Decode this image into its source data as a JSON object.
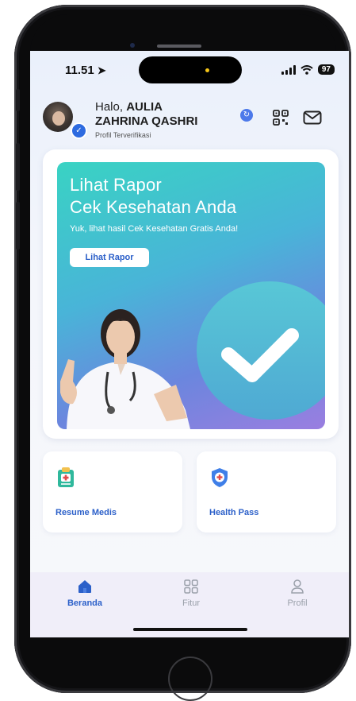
{
  "status_bar": {
    "time": "11.51",
    "location_glyph": "➤",
    "battery": "97"
  },
  "header": {
    "greeting_prefix": "Halo, ",
    "name_line1": "AULIA",
    "name_line2": "ZAHRINA QASHRI",
    "verified_label": "Profil Terverifikasi",
    "sync_glyph": "↻"
  },
  "banner": {
    "title_line1": "Lihat Rapor",
    "title_line2": "Cek Kesehatan Anda",
    "subtitle": "Yuk, lihat hasil Cek Kesehatan Gratis Anda!",
    "button_label": "Lihat Rapor"
  },
  "features": [
    {
      "label": "Resume Medis",
      "icon": "clipboard-medical-icon"
    },
    {
      "label": "Health Pass",
      "icon": "shield-medical-icon"
    }
  ],
  "tabbar": {
    "items": [
      {
        "label": "Beranda",
        "icon": "home-icon",
        "active": true
      },
      {
        "label": "Fitur",
        "icon": "grid-icon",
        "active": false
      },
      {
        "label": "Profil",
        "icon": "person-icon",
        "active": false
      }
    ]
  },
  "colors": {
    "accent": "#2c60c9",
    "banner_top": "#39d3c3",
    "banner_bottom": "#9a7ee0",
    "tab_inactive": "#9aa0aa"
  }
}
